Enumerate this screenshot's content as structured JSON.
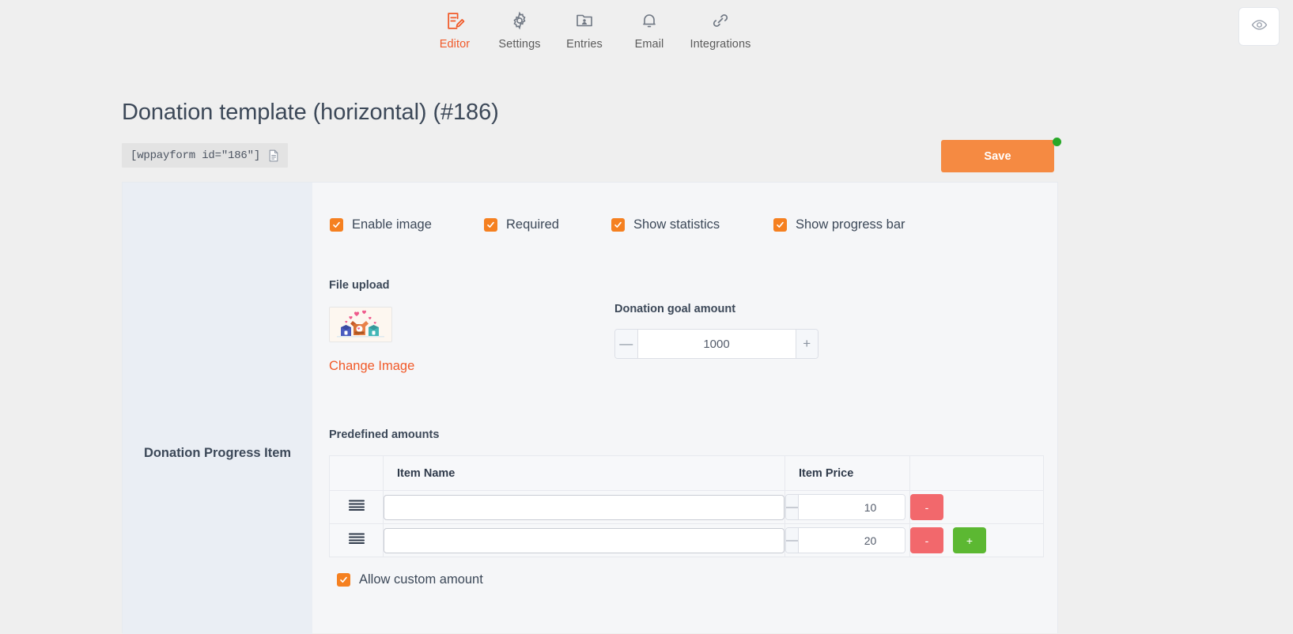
{
  "nav": {
    "items": [
      {
        "label": "Editor",
        "icon": "editor-icon",
        "active": true
      },
      {
        "label": "Settings",
        "icon": "gear-icon",
        "active": false
      },
      {
        "label": "Entries",
        "icon": "entries-icon",
        "active": false
      },
      {
        "label": "Email",
        "icon": "bell-icon",
        "active": false
      },
      {
        "label": "Integrations",
        "icon": "link-icon",
        "active": false
      }
    ],
    "preview_icon": "eye-icon"
  },
  "header": {
    "title": "Donation template (horizontal) (#186)",
    "shortcode": "[wppayform id=\"186\"]",
    "copy_icon": "copy-document-icon",
    "save_label": "Save",
    "accent_color": "#f58a42",
    "unsaved_dot_color": "#28a828"
  },
  "sidebar": {
    "item_label": "Donation Progress Item"
  },
  "options": {
    "toggles": [
      {
        "label": "Enable image",
        "checked": true
      },
      {
        "label": "Required",
        "checked": true
      },
      {
        "label": "Show statistics",
        "checked": true
      },
      {
        "label": "Show progress bar",
        "checked": true
      }
    ],
    "checkbox_color": "#f58020"
  },
  "upload": {
    "label": "File upload",
    "thumbnail_alt": "donation-boxes-with-hearts",
    "change_label": "Change Image",
    "change_color": "#f15a29"
  },
  "goal": {
    "label": "Donation goal amount",
    "value": "1000",
    "minus_label": "—",
    "plus_label": "+"
  },
  "predefined": {
    "label": "Predefined amounts",
    "columns": [
      "",
      "Item Name",
      "Item Price",
      ""
    ],
    "rows": [
      {
        "handle": "drag-handle",
        "name": "",
        "name_placeholder": "",
        "price": "10",
        "delete_label": "-",
        "add_label": null
      },
      {
        "handle": "drag-handle",
        "name": "",
        "name_placeholder": "",
        "price": "20",
        "delete_label": "-",
        "add_label": "+"
      }
    ],
    "delete_color": "#f2686c",
    "add_color": "#5cb832"
  },
  "allow_custom": {
    "label": "Allow custom amount",
    "checked": true
  }
}
